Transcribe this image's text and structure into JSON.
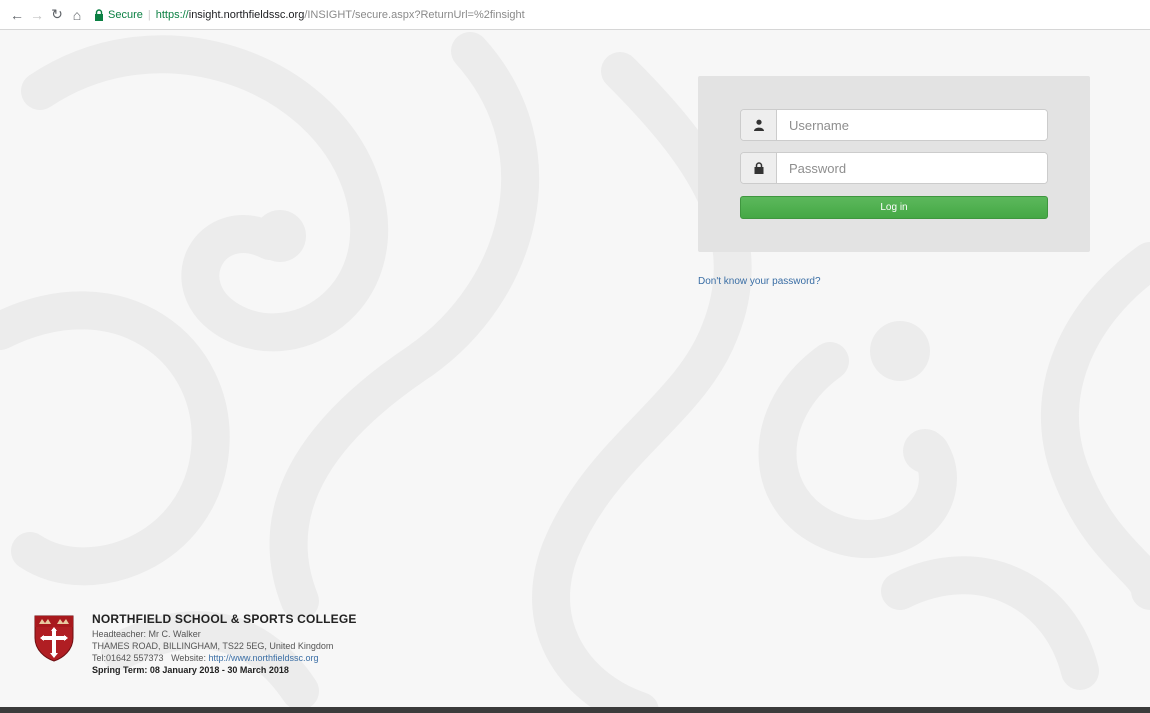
{
  "browser": {
    "secure_label": "Secure",
    "url_scheme": "https://",
    "url_host": "insight.northfieldssc.org",
    "url_path": "/INSIGHT/secure.aspx?ReturnUrl=%2finsight"
  },
  "login": {
    "username_placeholder": "Username",
    "password_placeholder": "Password",
    "login_label": "Log in",
    "forgot_label": "Don't know your password?"
  },
  "school": {
    "name": "NORTHFIELD SCHOOL & SPORTS COLLEGE",
    "headteacher": "Headteacher: Mr C. Walker",
    "address": "THAMES ROAD, BILLINGHAM, TS22 5EG, United Kingdom",
    "tel": "Tel:01642 557373",
    "website_prefix": "Website:",
    "website": "http://www.northfieldssc.org",
    "term": "Spring Term: 08 January 2018 - 30 March 2018"
  },
  "colors": {
    "button_green": "#5cb85c",
    "link_blue": "#3a6ea5",
    "panel_bg": "#e3e3e3"
  }
}
